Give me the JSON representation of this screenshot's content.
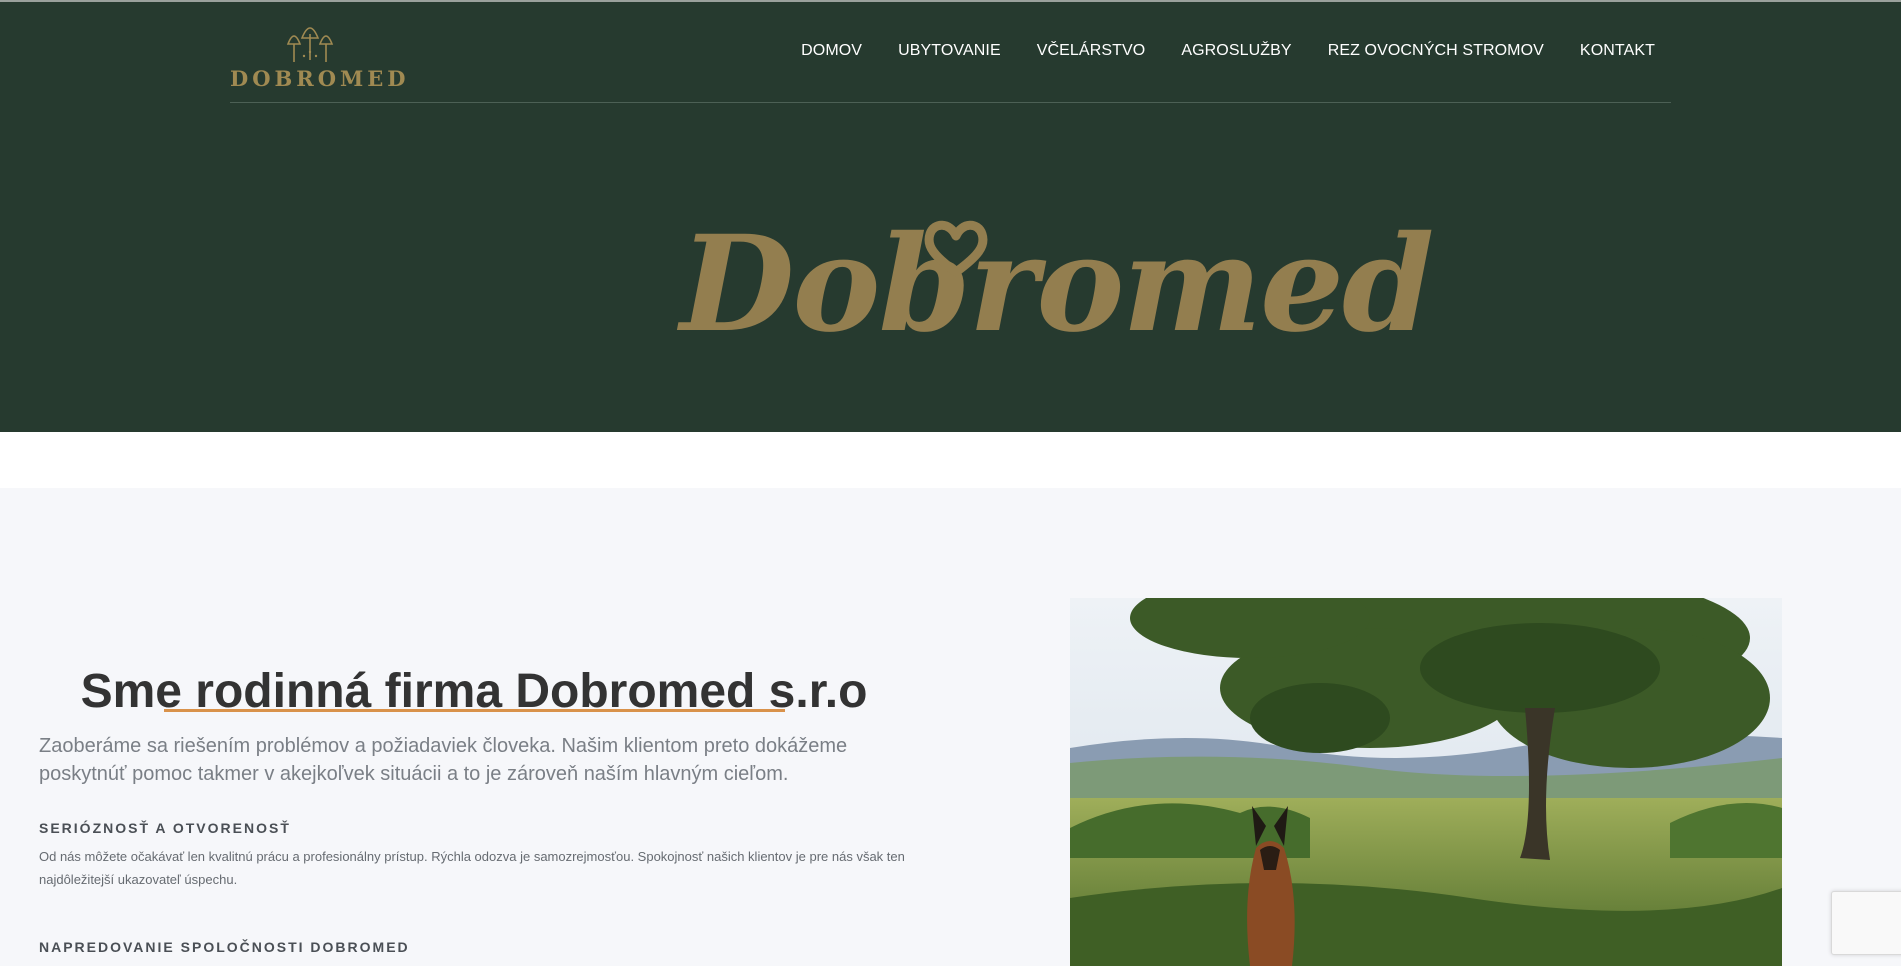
{
  "brand": {
    "name": "DOBROMED"
  },
  "nav": {
    "items": [
      "DOMOV",
      "UBYTOVANIE",
      "VČELÁRSTVO",
      "AGROSLUŽBY",
      "REZ OVOCNÝCH STROMOV",
      "KONTAKT"
    ]
  },
  "hero": {
    "script_logo": "Dobromed"
  },
  "intro": {
    "title": "Sme rodinná firma Dobromed s.r.o",
    "lead": "Zaoberáme sa riešením problémov a požiadaviek človeka. Našim klientom preto dokážeme poskytnúť pomoc takmer v akejkoľvek situácii a to je zároveň naším hlavným cieľom.",
    "blocks": [
      {
        "heading": "SERIÓZNOSŤ A OTVORENOSŤ",
        "text": "Od nás môžete očakávať len kvalitnú prácu a profesionálny prístup. Rýchla odozva je samozrejmosťou. Spokojnosť našich klientov je pre nás však ten najdôležitejší ukazovateľ úspechu."
      },
      {
        "heading": "NAPREDOVANIE SPOLOČNOSTI DOBROMED",
        "text": ""
      }
    ]
  },
  "colors": {
    "hero_bg": "#263a2f",
    "gold": "#937e4f",
    "accent": "#d9924a",
    "section_bg": "#f6f7fa"
  },
  "icons": {
    "logo": "trees-logo-icon",
    "heart": "heart-icon",
    "recaptcha": "recaptcha-badge-icon"
  }
}
